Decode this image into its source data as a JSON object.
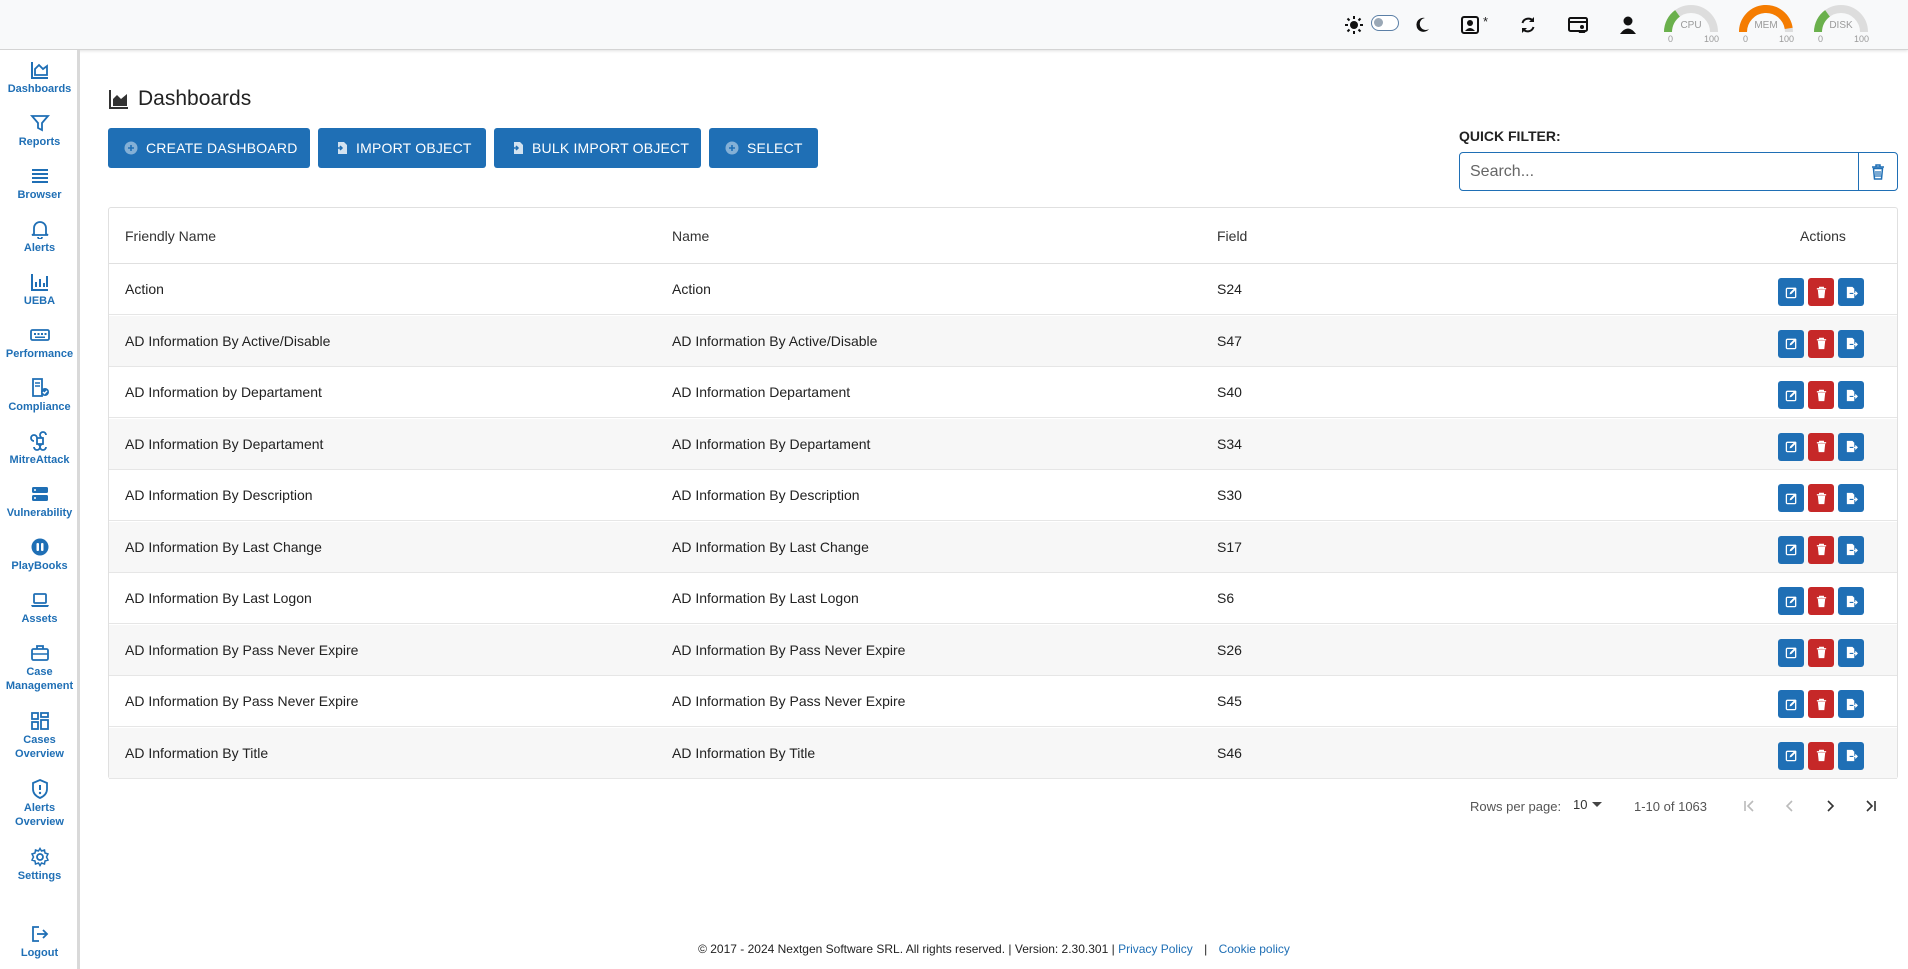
{
  "topbar": {
    "star_label": "*",
    "gauges": [
      {
        "label": "CPU",
        "min": "0",
        "max": "100",
        "value": 30,
        "color": "#6ab04c"
      },
      {
        "label": "MEM",
        "min": "0",
        "max": "100",
        "value": 95,
        "color": "#f57c00"
      },
      {
        "label": "DISK",
        "min": "0",
        "max": "100",
        "value": 30,
        "color": "#6ab04c"
      }
    ]
  },
  "sidebar": {
    "items": [
      {
        "label": "Dashboards",
        "icon": "chart-area-icon"
      },
      {
        "label": "Reports",
        "icon": "filter-icon"
      },
      {
        "label": "Browser",
        "icon": "list-icon"
      },
      {
        "label": "Alerts",
        "icon": "bell-icon"
      },
      {
        "label": "UEBA",
        "icon": "chart-bar-icon"
      },
      {
        "label": "Performance",
        "icon": "keyboard-icon"
      },
      {
        "label": "Compliance",
        "icon": "document-check-icon"
      },
      {
        "label": "MitreAttack",
        "icon": "command-icon"
      },
      {
        "label": "Vulnerability",
        "icon": "server-icon"
      },
      {
        "label": "PlayBooks",
        "icon": "playbook-icon"
      },
      {
        "label": "Assets",
        "icon": "laptop-icon"
      },
      {
        "label": "Case",
        "label2": "Management",
        "icon": "briefcase-icon"
      },
      {
        "label": "Cases",
        "label2": "Overview",
        "icon": "grid-icon"
      },
      {
        "label": "Alerts",
        "label2": "Overview",
        "icon": "shield-icon"
      },
      {
        "label": "Settings",
        "icon": "gear-icon"
      }
    ],
    "logout_label": "Logout"
  },
  "page": {
    "title": "Dashboards"
  },
  "toolbar": {
    "create_label": "CREATE DASHBOARD",
    "import_label": "IMPORT OBJECT",
    "bulk_import_label": "BULK IMPORT OBJECT",
    "select_label": "SELECT"
  },
  "quick_filter": {
    "label": "QUICK FILTER:",
    "placeholder": "Search...",
    "value": ""
  },
  "table": {
    "headers": {
      "friendly_name": "Friendly Name",
      "name": "Name",
      "field": "Field",
      "actions": "Actions"
    },
    "rows": [
      {
        "friendly_name": "Action",
        "name": "Action",
        "field": "S24"
      },
      {
        "friendly_name": "AD Information By Active/Disable",
        "name": "AD Information By Active/Disable",
        "field": "S47"
      },
      {
        "friendly_name": "AD Information by Departament",
        "name": "AD Information Departament",
        "field": "S40"
      },
      {
        "friendly_name": "AD Information By Departament",
        "name": "AD Information By Departament",
        "field": "S34"
      },
      {
        "friendly_name": "AD Information By Description",
        "name": "AD Information By Description",
        "field": "S30"
      },
      {
        "friendly_name": "AD Information By Last Change",
        "name": "AD Information By Last Change",
        "field": "S17"
      },
      {
        "friendly_name": "AD Information By Last Logon",
        "name": "AD Information By Last Logon",
        "field": "S6"
      },
      {
        "friendly_name": "AD Information By Pass Never Expire",
        "name": "AD Information By Pass Never Expire",
        "field": "S26"
      },
      {
        "friendly_name": "AD Information By Pass Never Expire",
        "name": "AD Information By Pass Never Expire",
        "field": "S45"
      },
      {
        "friendly_name": "AD Information By Title",
        "name": "AD Information By Title",
        "field": "S46"
      }
    ]
  },
  "pagination": {
    "rows_per_page_label": "Rows per page:",
    "rows_per_page_value": "10",
    "range_text": "1-10 of 1063"
  },
  "footer": {
    "copyright": "© 2017 - 2024 Nextgen Software SRL. All rights reserved. | Version: 2.30.301 |",
    "privacy_label": "Privacy Policy",
    "separator": "|",
    "cookie_label": "Cookie policy"
  },
  "colors": {
    "primary": "#1f6fb5",
    "danger": "#c62828"
  }
}
